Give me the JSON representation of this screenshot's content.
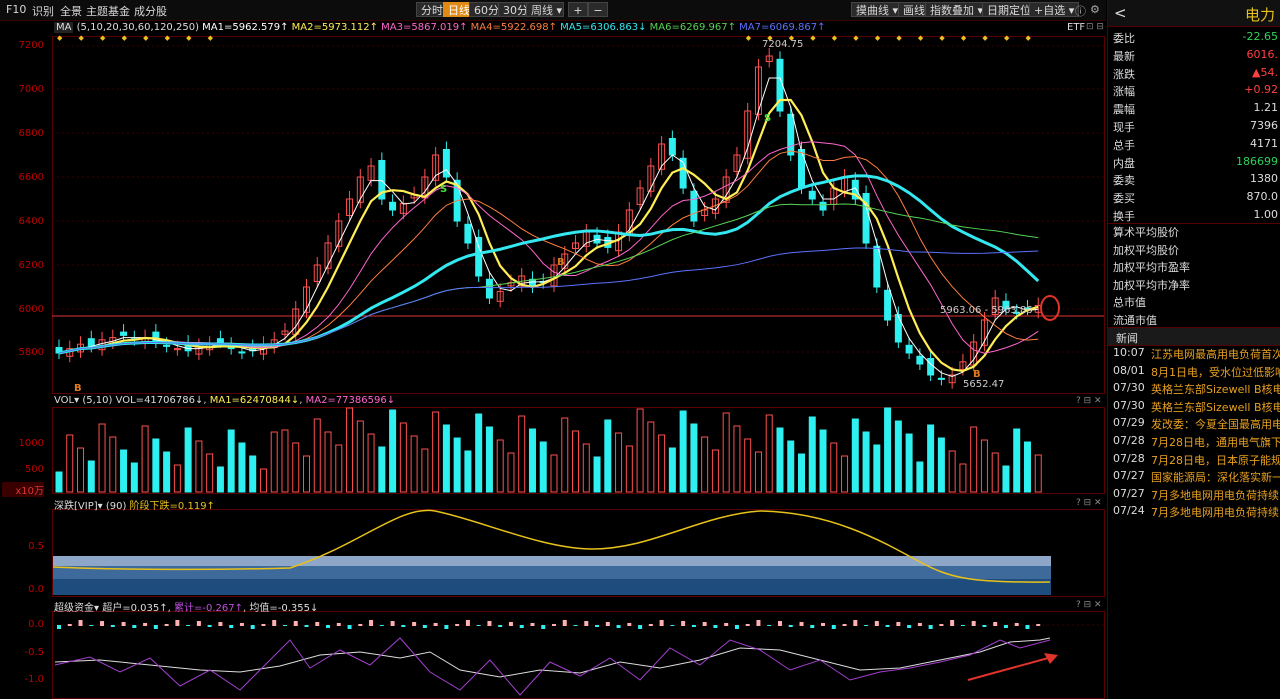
{
  "toolbar": {
    "f10": "F10",
    "identify": "识别",
    "all": "全景",
    "theme_fund": "主题基金",
    "components": "成分股",
    "periods": [
      "分时",
      "日线",
      "60分",
      "30分",
      "周线"
    ],
    "plus": "+",
    "minus": "−",
    "ma_line": "摸曲线",
    "draw": "画线",
    "index_add": "指数叠加",
    "date_locate": "日期定位",
    "self_select": "+自选",
    "help": "?"
  },
  "main_legend": {
    "ma_tag": "MA",
    "params": "(5,10,20,30,60,120,250)",
    "ma1": "MA1=5962.579↑",
    "ma2": "MA2=5973.112↑",
    "ma3": "MA3=5867.019↑",
    "ma4": "MA4=5922.698↑",
    "ma5": "MA5=6306.863↓",
    "ma6": "MA6=6269.967↑",
    "ma7": "MA7=6069.867↑",
    "etf": "ETF"
  },
  "main_axis": [
    "7200",
    "7000",
    "6800",
    "6600",
    "6400",
    "6200",
    "6000",
    "5800"
  ],
  "annotations": {
    "high": "7204.75",
    "low": "5652.47",
    "cur_label": "5963.06 - 5963.86",
    "b": "B",
    "s": "S"
  },
  "vol_legend": {
    "tag": "VOL",
    "params": "(5,10)",
    "vol": "VOL=41706786↓",
    "ma1": "MA1=62470844↓",
    "ma2": "MA2=77386596↓"
  },
  "vol_axis": [
    "1000",
    "500"
  ],
  "vol_unit": "x10万",
  "sd_legend": {
    "tag": "深跌[VIP]",
    "params": "(90)",
    "val": "阶段下跌=0.119↑"
  },
  "sd_axis": [
    "0.5",
    "0.0"
  ],
  "cj_legend": {
    "tag": "超级资金",
    "a": "超户=0.035↑",
    "b": "累计=-0.267↑",
    "c": "均值=-0.355↓"
  },
  "cj_axis": [
    "0.0",
    "-0.5",
    "-1.0"
  ],
  "right_panel": {
    "title": "电力",
    "back": "<",
    "rows": [
      {
        "label": "委比",
        "value": "-22.65",
        "color": "#2fd15a"
      },
      {
        "label": "最新",
        "value": "6016.",
        "color": "#ff4040"
      },
      {
        "label": "涨跌",
        "value": "▲54.",
        "color": "#ff4040"
      },
      {
        "label": "涨幅",
        "value": "+0.92",
        "color": "#ff4040"
      },
      {
        "label": "震幅",
        "value": "1.21",
        "color": "#ddd"
      },
      {
        "label": "现手",
        "value": "7396",
        "color": "#ddd"
      },
      {
        "label": "总手",
        "value": "4171",
        "color": "#ddd"
      },
      {
        "label": "内盘",
        "value": "186699",
        "color": "#2fd15a"
      },
      {
        "label": "委卖",
        "value": "1380",
        "color": "#ddd"
      },
      {
        "label": "委买",
        "value": "870.0",
        "color": "#ddd"
      },
      {
        "label": "换手",
        "value": "1.00",
        "color": "#ddd"
      }
    ],
    "metrics": [
      "算术平均股价",
      "加权平均股价",
      "加权平均市盈率",
      "加权平均市净率",
      "总市值",
      "流通市值"
    ],
    "news_title": "新闻",
    "news": [
      {
        "date": "10:07",
        "text": "江苏电网最高用电负荷首次"
      },
      {
        "date": "08/01",
        "text": "8月1日电，受水位过低影响"
      },
      {
        "date": "07/30",
        "text": "英格兰东部Sizewell B核电"
      },
      {
        "date": "07/30",
        "text": "英格兰东部Sizewell B核电"
      },
      {
        "date": "07/29",
        "text": "发改委：今夏全国最高用电"
      },
      {
        "date": "07/28",
        "text": "7月28日电，通用电气旗下"
      },
      {
        "date": "07/28",
        "text": "7月28日电，日本原子能规"
      },
      {
        "date": "07/27",
        "text": "国家能源局：深化落实新一"
      },
      {
        "date": "07/27",
        "text": "7月多地电网用电负荷持续"
      },
      {
        "date": "07/24",
        "text": "7月多地电网用电负荷持续"
      }
    ]
  }
}
